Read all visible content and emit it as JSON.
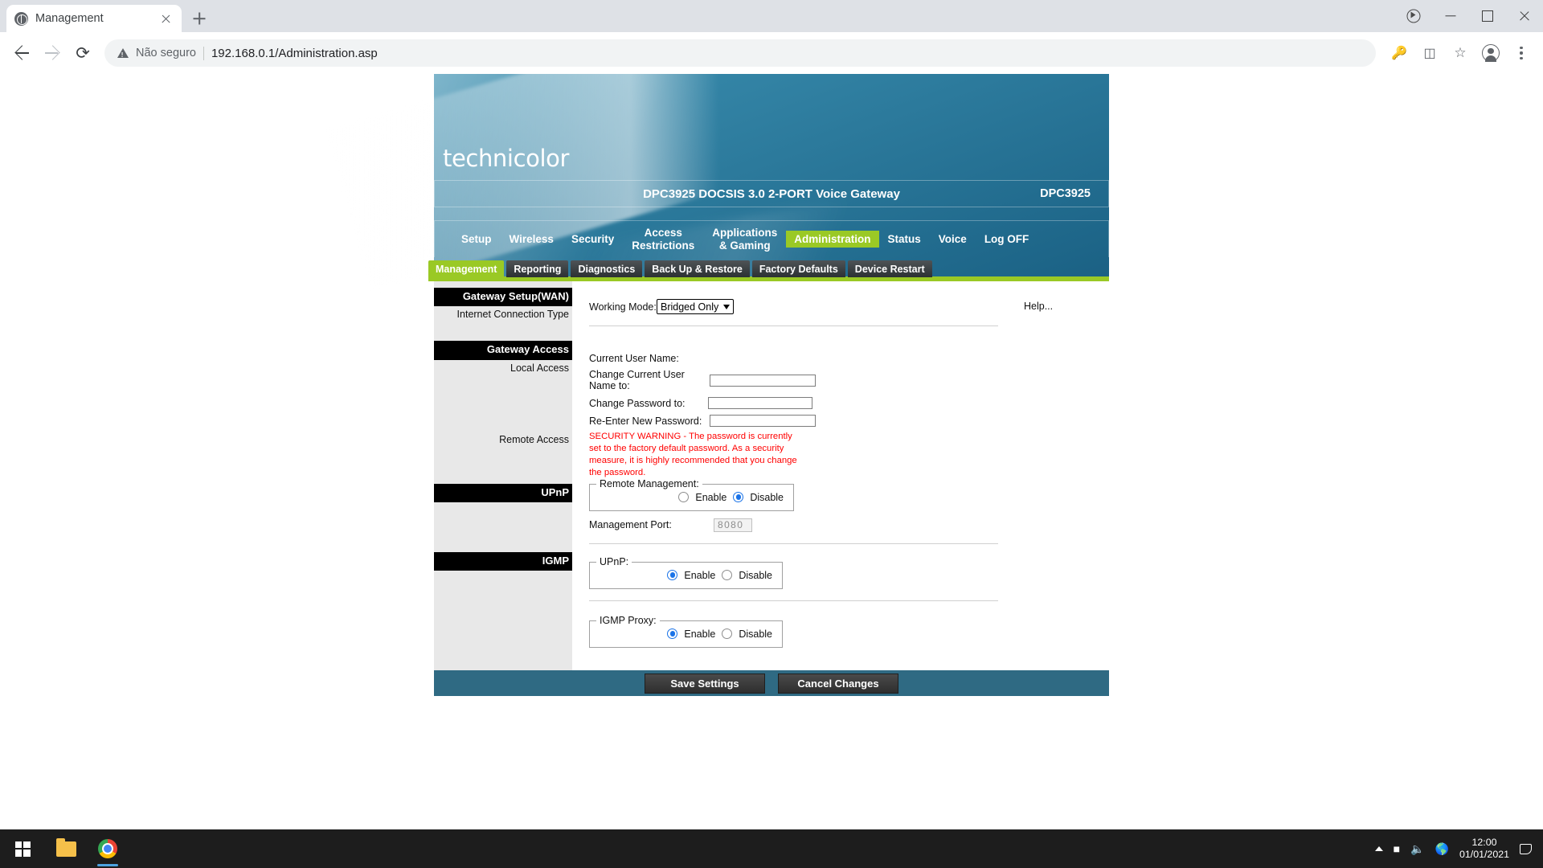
{
  "browser": {
    "tab": {
      "title": "Management",
      "favicon": "globe-icon",
      "close": "close-icon"
    },
    "new_tab": "+",
    "window_controls": {
      "profile": "user-circle-icon",
      "minimize": "−",
      "maximize": "□",
      "close": "✕"
    },
    "nav": {
      "back": "←",
      "forward": "→",
      "reload": "⟳"
    },
    "omnibox": {
      "security_label": "Não seguro",
      "url": "192.168.0.1/Administration.asp",
      "warning_icon": "warning-triangle-icon"
    },
    "toolbar_icons": [
      "key-icon",
      "cast-icon",
      "star-icon",
      "profile-icon",
      "menu-kebab-icon"
    ]
  },
  "router": {
    "brand": "technicolor",
    "model_bar": {
      "title": "DPC3925 DOCSIS 3.0 2-PORT Voice Gateway",
      "model": "DPC3925"
    },
    "nav_items": [
      {
        "label": "Setup",
        "active": false
      },
      {
        "label": "Wireless",
        "active": false
      },
      {
        "label": "Security",
        "active": false
      },
      {
        "label": "Access\nRestrictions",
        "active": false
      },
      {
        "label": "Applications\n& Gaming",
        "active": false
      },
      {
        "label": "Administration",
        "active": true
      },
      {
        "label": "Status",
        "active": false
      },
      {
        "label": "Voice",
        "active": false
      },
      {
        "label": "Log OFF",
        "active": false
      }
    ],
    "sub_tabs": [
      {
        "label": "Management",
        "active": true
      },
      {
        "label": "Reporting",
        "active": false
      },
      {
        "label": "Diagnostics",
        "active": false
      },
      {
        "label": "Back Up & Restore",
        "active": false
      },
      {
        "label": "Factory Defaults",
        "active": false
      },
      {
        "label": "Device Restart",
        "active": false
      }
    ],
    "sidebar": {
      "gateway_setup_head": "Gateway Setup(WAN)",
      "internet_connection_type": "Internet Connection Type",
      "gateway_access_head": "Gateway Access",
      "local_access": "Local Access",
      "remote_access": "Remote Access",
      "upnp_head": "UPnP",
      "igmp_head": "IGMP"
    },
    "form": {
      "working_mode_label": "Working Mode:",
      "working_mode_value": "Bridged Only",
      "working_mode_options": [
        "Bridged Only"
      ],
      "current_user_name_label": "Current User Name:",
      "current_user_name_value": "",
      "change_user_name_label": "Change Current User Name to:",
      "change_user_name_value": "",
      "change_password_label": "Change Password to:",
      "change_password_value": "",
      "reenter_password_label": "Re-Enter New Password:",
      "reenter_password_value": "",
      "security_warning": "SECURITY WARNING - The password is currently set to the factory default password. As a security measure, it is highly recommended that you change the password.",
      "remote_management": {
        "legend": "Remote Management:",
        "enable_label": "Enable",
        "disable_label": "Disable",
        "selected": "Disable"
      },
      "management_port_label": "Management Port:",
      "management_port_value": "8080",
      "upnp": {
        "legend": "UPnP:",
        "enable_label": "Enable",
        "disable_label": "Disable",
        "selected": "Enable"
      },
      "igmp_proxy": {
        "legend": "IGMP Proxy:",
        "enable_label": "Enable",
        "disable_label": "Disable",
        "selected": "Enable"
      }
    },
    "help_link": "Help...",
    "buttons": {
      "save": "Save Settings",
      "cancel": "Cancel Changes"
    },
    "colors": {
      "accent_green": "#9ac925",
      "header_blue": "#1d6588",
      "warning_red": "#ff0000",
      "radio_blue": "#1a73e8"
    }
  },
  "taskbar": {
    "start": "windows-logo-icon",
    "apps": [
      "file-explorer-icon",
      "chrome-icon"
    ],
    "tray": [
      "show-hidden-icons",
      "battery-icon",
      "volume-icon",
      "network-icon",
      "notification-icon"
    ],
    "clock_time": "12:00",
    "clock_date": "01/01/2021"
  }
}
